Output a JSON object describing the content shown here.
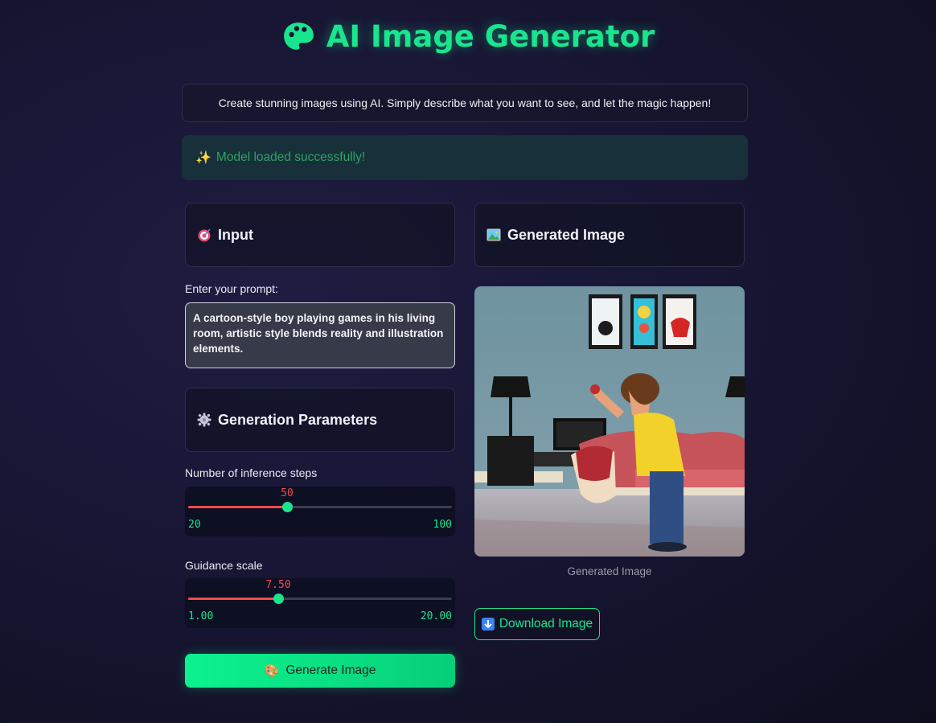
{
  "header": {
    "title": "AI Image Generator",
    "icon": "palette-icon",
    "accent_color": "#19e58e"
  },
  "description": "Create stunning images using AI. Simply describe what you want to see, and let the magic happen!",
  "status": {
    "icon": "sparkles-icon",
    "message": "Model loaded successfully!",
    "color": "#2fa363"
  },
  "input_panel": {
    "icon": "target-icon",
    "title": "Input",
    "prompt_label": "Enter your prompt:",
    "prompt_value": "A cartoon-style boy playing games in his living room, artistic style blends reality and illustration elements."
  },
  "params_panel": {
    "icon": "gear-icon",
    "title": "Generation Parameters",
    "steps": {
      "label": "Number of inference steps",
      "value": "50",
      "min": "20",
      "max": "100",
      "fraction": 0.375
    },
    "guidance": {
      "label": "Guidance scale",
      "value": "7.50",
      "min": "1.00",
      "max": "20.00",
      "fraction": 0.342
    }
  },
  "generate_button": {
    "icon": "palette-icon",
    "label": "Generate Image"
  },
  "output_panel": {
    "icon": "framed-picture-icon",
    "title": "Generated Image",
    "caption": "Generated Image",
    "download_label": "Download Image",
    "download_icon": "down-arrow-icon"
  }
}
